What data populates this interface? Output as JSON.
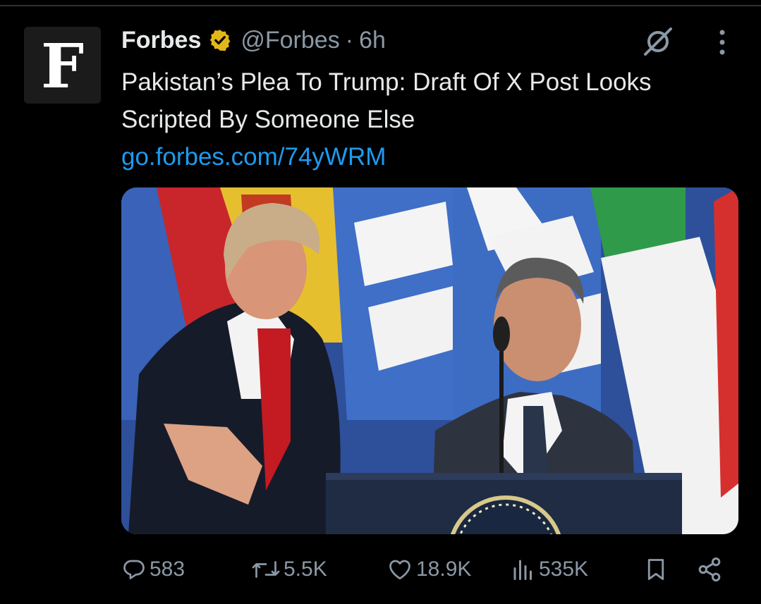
{
  "author": {
    "avatar_letter": "F",
    "name": "Forbes",
    "verified": "gold-verified-badge-icon",
    "handle": "@Forbes",
    "separator": "·",
    "time": "6h"
  },
  "post": {
    "text": "Pakistan’s Plea To Trump: Draft Of X Post Looks Scripted By Someone Else",
    "link": "go.forbes.com/74yWRM"
  },
  "media": {
    "icon": "photo-image"
  },
  "actions": {
    "replies": "583",
    "reposts": "5.5K",
    "likes": "18.9K",
    "views": "535K"
  },
  "icons": {
    "grok": "grok-slash-icon",
    "more": "more-vertical-icon",
    "reply": "reply-bubble-icon",
    "repost": "repost-arrows-icon",
    "like": "heart-icon",
    "views": "views-bars-icon",
    "bookmark": "bookmark-icon",
    "share": "share-icon"
  },
  "colors": {
    "background": "#000000",
    "text": "#e7e9ea",
    "muted": "#8b98a5",
    "link": "#1d9bf0",
    "verified_gold": "#e2b719"
  }
}
